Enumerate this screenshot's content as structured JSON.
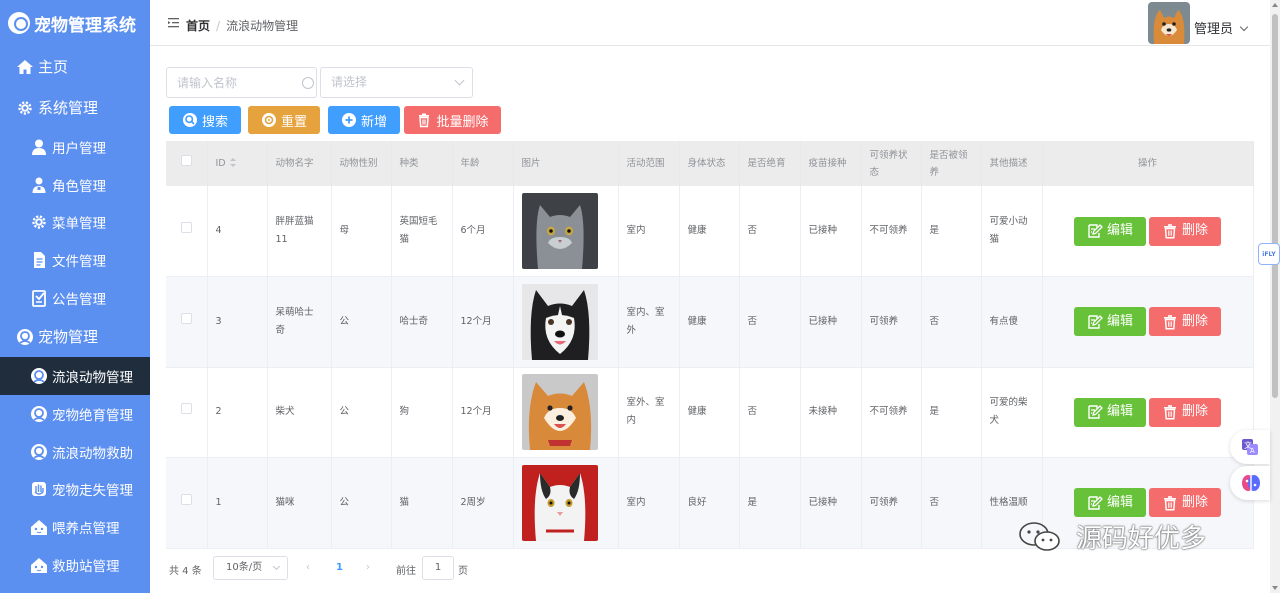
{
  "app": {
    "title": "宠物管理系统"
  },
  "sidebar": {
    "items": [
      {
        "label": "主页",
        "icon": "home-icon"
      },
      {
        "label": "系统管理",
        "icon": "gear-icon"
      },
      {
        "label": "用户管理",
        "icon": "user-icon"
      },
      {
        "label": "角色管理",
        "icon": "role-icon"
      },
      {
        "label": "菜单管理",
        "icon": "gear-icon"
      },
      {
        "label": "文件管理",
        "icon": "file-icon"
      },
      {
        "label": "公告管理",
        "icon": "notice-icon"
      },
      {
        "label": "宠物管理",
        "icon": "pet-icon"
      },
      {
        "label": "流浪动物管理",
        "icon": "pet-icon",
        "active": true
      },
      {
        "label": "宠物绝育管理",
        "icon": "pet-icon"
      },
      {
        "label": "流浪动物救助",
        "icon": "pet-icon"
      },
      {
        "label": "宠物走失管理",
        "icon": "hand-icon"
      },
      {
        "label": "喂养点管理",
        "icon": "house-icon"
      },
      {
        "label": "救助站管理",
        "icon": "house-icon"
      }
    ]
  },
  "header": {
    "breadcrumb_home": "首页",
    "breadcrumb_sep": "/",
    "breadcrumb_current": "流浪动物管理",
    "user_name": "管理员"
  },
  "filters": {
    "name_placeholder": "请输入名称",
    "select_placeholder": "请选择"
  },
  "toolbar": {
    "search_label": "搜索",
    "reset_label": "重置",
    "add_label": "新增",
    "batch_delete_label": "批量删除"
  },
  "table": {
    "columns": [
      "ID",
      "动物名字",
      "动物性别",
      "种类",
      "年龄",
      "图片",
      "活动范围",
      "身体状态",
      "是否绝育",
      "疫苗接种",
      "可领养状态",
      "是否被领养",
      "其他描述",
      "操作"
    ],
    "edit_label": "编辑",
    "delete_label": "删除",
    "rows": [
      {
        "id": "4",
        "name": "胖胖蓝猫11",
        "gender": "母",
        "species": "英国短毛猫",
        "age": "6个月",
        "image": "gray-cat",
        "range": "室内",
        "health": "健康",
        "neutered": "否",
        "vaccine": "已接种",
        "adoptable": "不可领养",
        "adopted": "是",
        "desc": "可爱小动猫"
      },
      {
        "id": "3",
        "name": "呆萌哈士奇",
        "gender": "公",
        "species": "哈士奇",
        "age": "12个月",
        "image": "husky",
        "range": "室内、室外",
        "health": "健康",
        "neutered": "否",
        "vaccine": "已接种",
        "adoptable": "可领养",
        "adopted": "否",
        "desc": "有点傻"
      },
      {
        "id": "2",
        "name": "柴犬",
        "gender": "公",
        "species": "狗",
        "age": "12个月",
        "image": "shiba",
        "range": "室外、室内",
        "health": "健康",
        "neutered": "否",
        "vaccine": "未接种",
        "adoptable": "不可领养",
        "adopted": "是",
        "desc": "可爱的柴犬"
      },
      {
        "id": "1",
        "name": "猫咪",
        "gender": "公",
        "species": "猫",
        "age": "2周岁",
        "image": "white-cat",
        "range": "室内",
        "health": "良好",
        "neutered": "是",
        "vaccine": "已接种",
        "adoptable": "可领养",
        "adopted": "否",
        "desc": "性格温顺"
      }
    ]
  },
  "pagination": {
    "total": "共 4 条",
    "page_size": "10条/页",
    "prev": "‹",
    "current_page": "1",
    "next": "›",
    "goto_label": "前往",
    "goto_value": "1",
    "goto_unit": "页"
  },
  "watermark": "源码好优多",
  "floating_badge": "iFLY"
}
